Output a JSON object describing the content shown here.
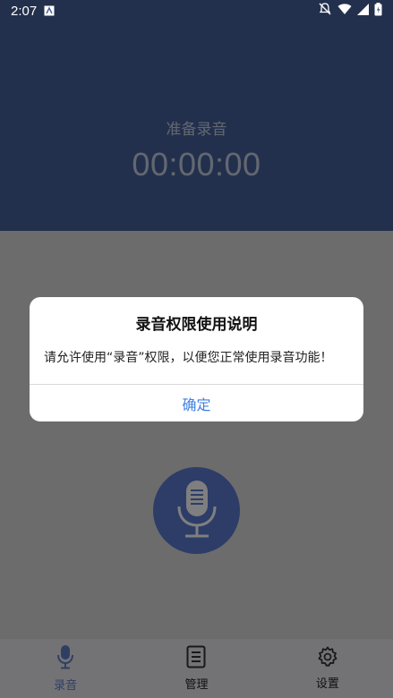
{
  "status_bar": {
    "time": "2:07"
  },
  "header": {
    "state": "准备录音",
    "timer": "00:00:00"
  },
  "record_button": {
    "icon": "microphone-icon"
  },
  "bottom_nav": {
    "items": [
      {
        "label": "录音",
        "icon": "mic-icon"
      },
      {
        "label": "管理",
        "icon": "document-icon"
      },
      {
        "label": "设置",
        "icon": "gear-icon"
      }
    ]
  },
  "dialog": {
    "title": "录音权限使用说明",
    "message": "请允许使用“录音”权限，以便您正常使用录音功能！",
    "confirm": "确定"
  },
  "colors": {
    "header_bg": "#45619a",
    "record_button": "#5b7ad0",
    "nav_active": "#5f7fc7",
    "dialog_link": "#3f7fe0"
  }
}
